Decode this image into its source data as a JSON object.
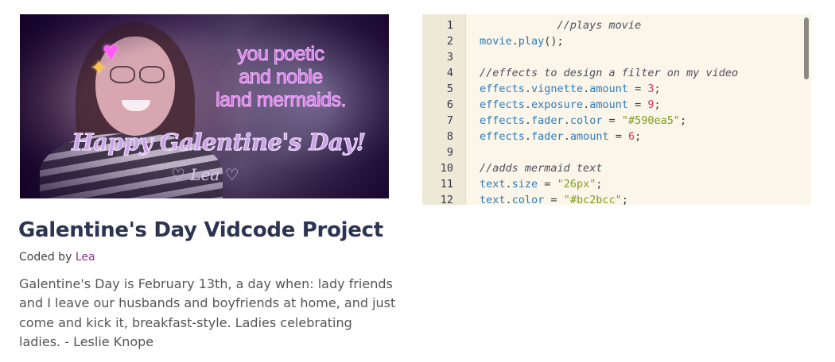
{
  "video": {
    "overlay_lines": [
      "you poetic",
      "and noble",
      "land mermaids."
    ],
    "caption": "Happy Galentine's Day!",
    "signature": "♡ Lea ♡",
    "stickers": [
      "heart-icon",
      "sparkles-icon"
    ]
  },
  "editor": {
    "colors": {
      "object": "#2f7ab9",
      "number": "#d23b5a",
      "string": "#7f9c1c",
      "comment": "#4c4f5e"
    },
    "lines": [
      {
        "n": "1",
        "tokens": [
          {
            "t": "            //plays movie",
            "k": "com"
          }
        ]
      },
      {
        "n": "2",
        "tokens": [
          {
            "t": "movie",
            "k": "obj"
          },
          {
            "t": ".",
            "k": "punc"
          },
          {
            "t": "play",
            "k": "obj"
          },
          {
            "t": "();",
            "k": "punc"
          }
        ]
      },
      {
        "n": "3",
        "tokens": []
      },
      {
        "n": "4",
        "tokens": [
          {
            "t": "//effects to design a filter on my video",
            "k": "com"
          }
        ]
      },
      {
        "n": "5",
        "tokens": [
          {
            "t": "effects",
            "k": "obj"
          },
          {
            "t": ".",
            "k": "punc"
          },
          {
            "t": "vignette",
            "k": "obj"
          },
          {
            "t": ".",
            "k": "punc"
          },
          {
            "t": "amount",
            "k": "obj"
          },
          {
            "t": " = ",
            "k": "punc"
          },
          {
            "t": "3",
            "k": "num"
          },
          {
            "t": ";",
            "k": "punc"
          }
        ]
      },
      {
        "n": "6",
        "tokens": [
          {
            "t": "effects",
            "k": "obj"
          },
          {
            "t": ".",
            "k": "punc"
          },
          {
            "t": "exposure",
            "k": "obj"
          },
          {
            "t": ".",
            "k": "punc"
          },
          {
            "t": "amount",
            "k": "obj"
          },
          {
            "t": " = ",
            "k": "punc"
          },
          {
            "t": "9",
            "k": "num"
          },
          {
            "t": ";",
            "k": "punc"
          }
        ]
      },
      {
        "n": "7",
        "tokens": [
          {
            "t": "effects",
            "k": "obj"
          },
          {
            "t": ".",
            "k": "punc"
          },
          {
            "t": "fader",
            "k": "obj"
          },
          {
            "t": ".",
            "k": "punc"
          },
          {
            "t": "color",
            "k": "obj"
          },
          {
            "t": " = ",
            "k": "punc"
          },
          {
            "t": "\"#590ea5\"",
            "k": "str"
          },
          {
            "t": ";",
            "k": "punc"
          }
        ]
      },
      {
        "n": "8",
        "tokens": [
          {
            "t": "effects",
            "k": "obj"
          },
          {
            "t": ".",
            "k": "punc"
          },
          {
            "t": "fader",
            "k": "obj"
          },
          {
            "t": ".",
            "k": "punc"
          },
          {
            "t": "amount",
            "k": "obj"
          },
          {
            "t": " = ",
            "k": "punc"
          },
          {
            "t": "6",
            "k": "num"
          },
          {
            "t": ";",
            "k": "punc"
          }
        ]
      },
      {
        "n": "9",
        "tokens": []
      },
      {
        "n": "10",
        "tokens": [
          {
            "t": "//adds mermaid text",
            "k": "com"
          }
        ]
      },
      {
        "n": "11",
        "tokens": [
          {
            "t": "text",
            "k": "obj"
          },
          {
            "t": ".",
            "k": "punc"
          },
          {
            "t": "size",
            "k": "obj"
          },
          {
            "t": " = ",
            "k": "punc"
          },
          {
            "t": "\"26px\"",
            "k": "str"
          },
          {
            "t": ";",
            "k": "punc"
          }
        ]
      },
      {
        "n": "12",
        "tokens": [
          {
            "t": "text",
            "k": "obj"
          },
          {
            "t": ".",
            "k": "punc"
          },
          {
            "t": "color",
            "k": "obj"
          },
          {
            "t": " = ",
            "k": "punc"
          },
          {
            "t": "\"#bc2bcc\"",
            "k": "str"
          },
          {
            "t": ";",
            "k": "punc"
          }
        ]
      }
    ]
  },
  "project": {
    "title": "Galentine's Day Vidcode Project",
    "coded_by_label": "Coded by",
    "author": "Lea",
    "description": "Galentine's Day is February 13th, a day when: lady friends and I leave our husbands and boyfriends at home, and just come and kick it, breakfast-style. Ladies celebrating ladies. - Leslie Knope"
  }
}
